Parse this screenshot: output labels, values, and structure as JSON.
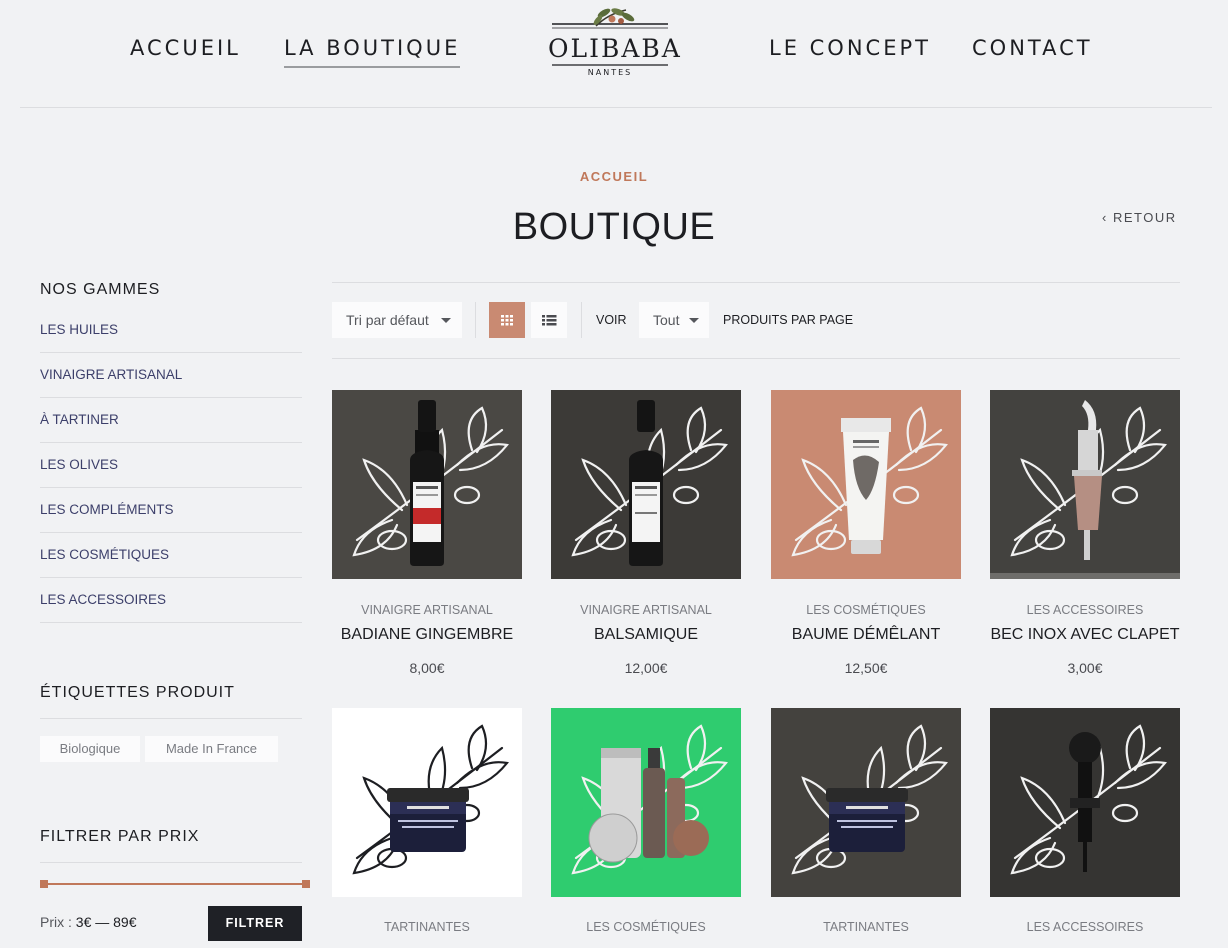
{
  "header": {
    "nav_left": [
      "ACCUEIL",
      "LA BOUTIQUE"
    ],
    "nav_right": [
      "LE CONCEPT",
      "CONTACT"
    ],
    "logo_name": "OLIBABA",
    "logo_city": "NANTES"
  },
  "page": {
    "breadcrumb": "ACCUEIL",
    "title": "BOUTIQUE",
    "back": "RETOUR"
  },
  "sidebar": {
    "ranges_heading": "NOS GAMMES",
    "categories": [
      "LES HUILES",
      "VINAIGRE ARTISANAL",
      "À TARTINER",
      "LES OLIVES",
      "LES COMPLÉMENTS",
      "LES COSMÉTIQUES",
      "LES ACCESSOIRES"
    ],
    "tags_heading": "ÉTIQUETTES PRODUIT",
    "tags": [
      "Biologique",
      "Made In France"
    ],
    "price_heading": "FILTRER PAR PRIX",
    "price_prefix": "Prix :",
    "price_range": "3€ — 89€",
    "filter_button": "FILTRER"
  },
  "toolbar": {
    "sort_value": "Tri par défaut",
    "view_label": "VOIR",
    "per_page_value": "Tout",
    "per_page_label": "PRODUITS PAR PAGE",
    "active_view": "grid"
  },
  "products": [
    {
      "category": "VINAIGRE ARTISANAL",
      "name": "BADIANE GINGEMBRE",
      "price": "8,00€",
      "bg": "#4a4844",
      "item": "bottle-red"
    },
    {
      "category": "VINAIGRE ARTISANAL",
      "name": "BALSAMIQUE",
      "price": "12,00€",
      "bg": "#3c3a37",
      "item": "bottle-dark"
    },
    {
      "category": "LES COSMÉTIQUES",
      "name": "BAUME DÉMÊLANT",
      "price": "12,50€",
      "bg": "#c98a72",
      "item": "tube"
    },
    {
      "category": "LES ACCESSOIRES",
      "name": "BEC INOX AVEC CLAPET",
      "price": "3,00€",
      "bg": "#43423f",
      "item": "spout"
    },
    {
      "category": "TARTINANTES",
      "name": "",
      "price": "",
      "bg": "#ffffff",
      "item": "jar-white"
    },
    {
      "category": "LES COSMÉTIQUES",
      "name": "",
      "price": "",
      "bg": "#2fcc6f",
      "item": "giftset"
    },
    {
      "category": "TARTINANTES",
      "name": "",
      "price": "",
      "bg": "#44423e",
      "item": "jar-dark"
    },
    {
      "category": "LES ACCESSOIRES",
      "name": "",
      "price": "",
      "bg": "#353432",
      "item": "pourer"
    }
  ],
  "colors": {
    "accent": "#c0785a",
    "text": "#1d1e22",
    "background": "#f1f2f4"
  }
}
